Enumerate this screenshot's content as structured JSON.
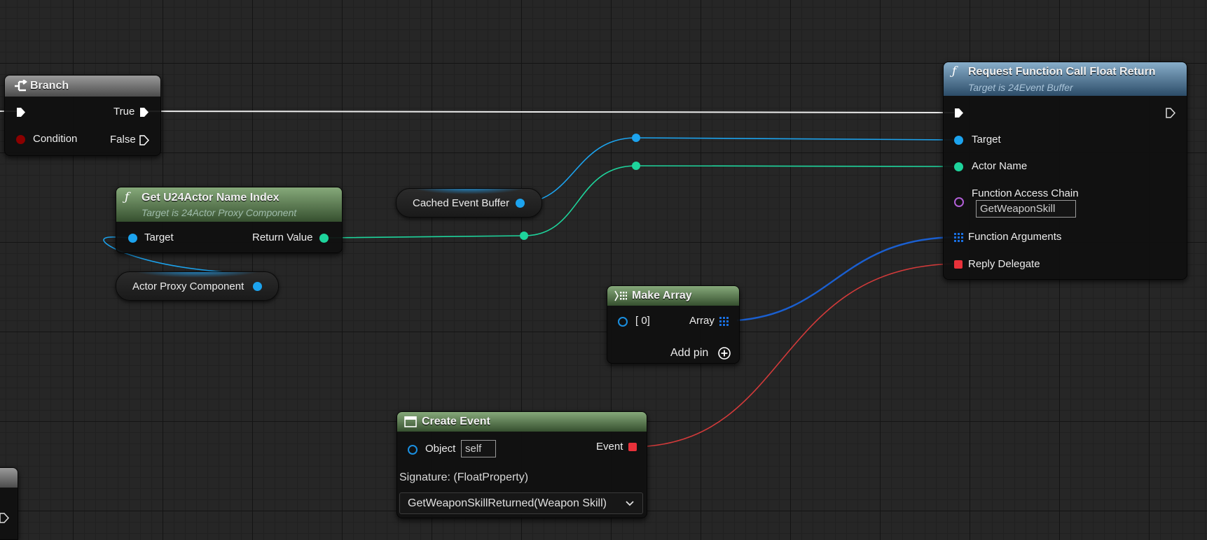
{
  "nodes": {
    "branch": {
      "title": "Branch",
      "pins": {
        "condition": "Condition",
        "true": "True",
        "false": "False"
      }
    },
    "get_name_index": {
      "title": "Get U24Actor Name Index",
      "subtitle": "Target is 24Actor Proxy Component",
      "pins": {
        "target": "Target",
        "return_value": "Return Value"
      }
    },
    "cached_event_buffer": {
      "label": "Cached Event Buffer"
    },
    "actor_proxy_component": {
      "label": "Actor Proxy Component"
    },
    "request_call": {
      "title": "Request Function Call Float Return",
      "subtitle": "Target is 24Event Buffer",
      "pins": {
        "target": "Target",
        "actor_name": "Actor Name",
        "function_access_chain": "Function Access Chain",
        "function_access_chain_value": "GetWeaponSkill",
        "function_arguments": "Function Arguments",
        "reply_delegate": "Reply Delegate"
      }
    },
    "make_array": {
      "title": "Make Array",
      "pins": {
        "element0": "[ 0]",
        "array": "Array",
        "add_pin": "Add pin"
      }
    },
    "create_event": {
      "title": "Create Event",
      "pins": {
        "object": "Object",
        "object_value": "self",
        "event": "Event",
        "signature": "Signature: (FloatProperty)",
        "function_select": "GetWeaponSkillReturned(Weapon Skill)"
      }
    }
  },
  "colors": {
    "exec": "#ffffff",
    "object_pin": "#1ca3ee",
    "name_pin": "#1ed49c",
    "delegate_pin": "#e8313a",
    "array_pin": "#1a5fd0",
    "function_header": "#4a6b44",
    "target_header": "#3e6384"
  },
  "icons": [
    "branch-icon",
    "function-icon",
    "make-array-icon",
    "create-event-icon",
    "add-pin-icon",
    "chevron-down-icon"
  ]
}
